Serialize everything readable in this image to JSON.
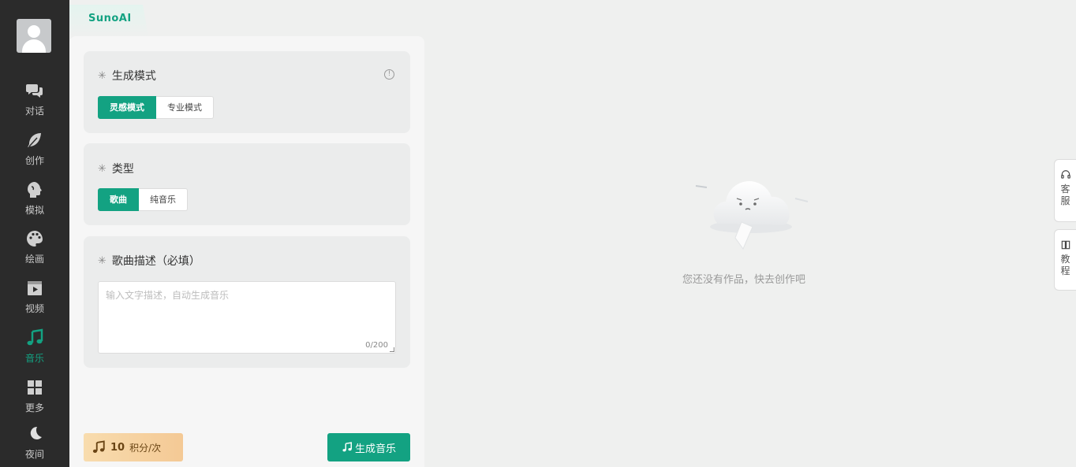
{
  "sidebar": {
    "items": [
      {
        "label": "对话",
        "icon": "chat-bubbles-icon"
      },
      {
        "label": "创作",
        "icon": "feather-icon"
      },
      {
        "label": "模拟",
        "icon": "head-profile-icon"
      },
      {
        "label": "绘画",
        "icon": "palette-icon"
      },
      {
        "label": "视频",
        "icon": "video-icon"
      },
      {
        "label": "音乐",
        "icon": "music-note-icon",
        "active": true
      },
      {
        "label": "更多",
        "icon": "grid-icon"
      },
      {
        "label": "夜间",
        "icon": "moon-icon"
      }
    ]
  },
  "tab": {
    "label": "SunoAI"
  },
  "mode_section": {
    "title": "生成模式",
    "options": [
      "灵感模式",
      "专业模式"
    ],
    "selected": "灵感模式"
  },
  "type_section": {
    "title": "类型",
    "options": [
      "歌曲",
      "纯音乐"
    ],
    "selected": "歌曲"
  },
  "desc_section": {
    "title": "歌曲描述（必填）",
    "placeholder": "输入文字描述，自动生成音乐",
    "value": "",
    "counter": "0/200"
  },
  "footer": {
    "cost_number": "10",
    "cost_unit": "积分/次",
    "generate_label": "生成音乐"
  },
  "empty_state": {
    "message": "您还没有作品，快去创作吧"
  },
  "floating": {
    "service_label": "客服",
    "tutorial_label": "教程"
  },
  "colors": {
    "accent": "#13a282",
    "sidebar_bg": "#2b2b2b",
    "cost_badge": "#f4c995"
  }
}
